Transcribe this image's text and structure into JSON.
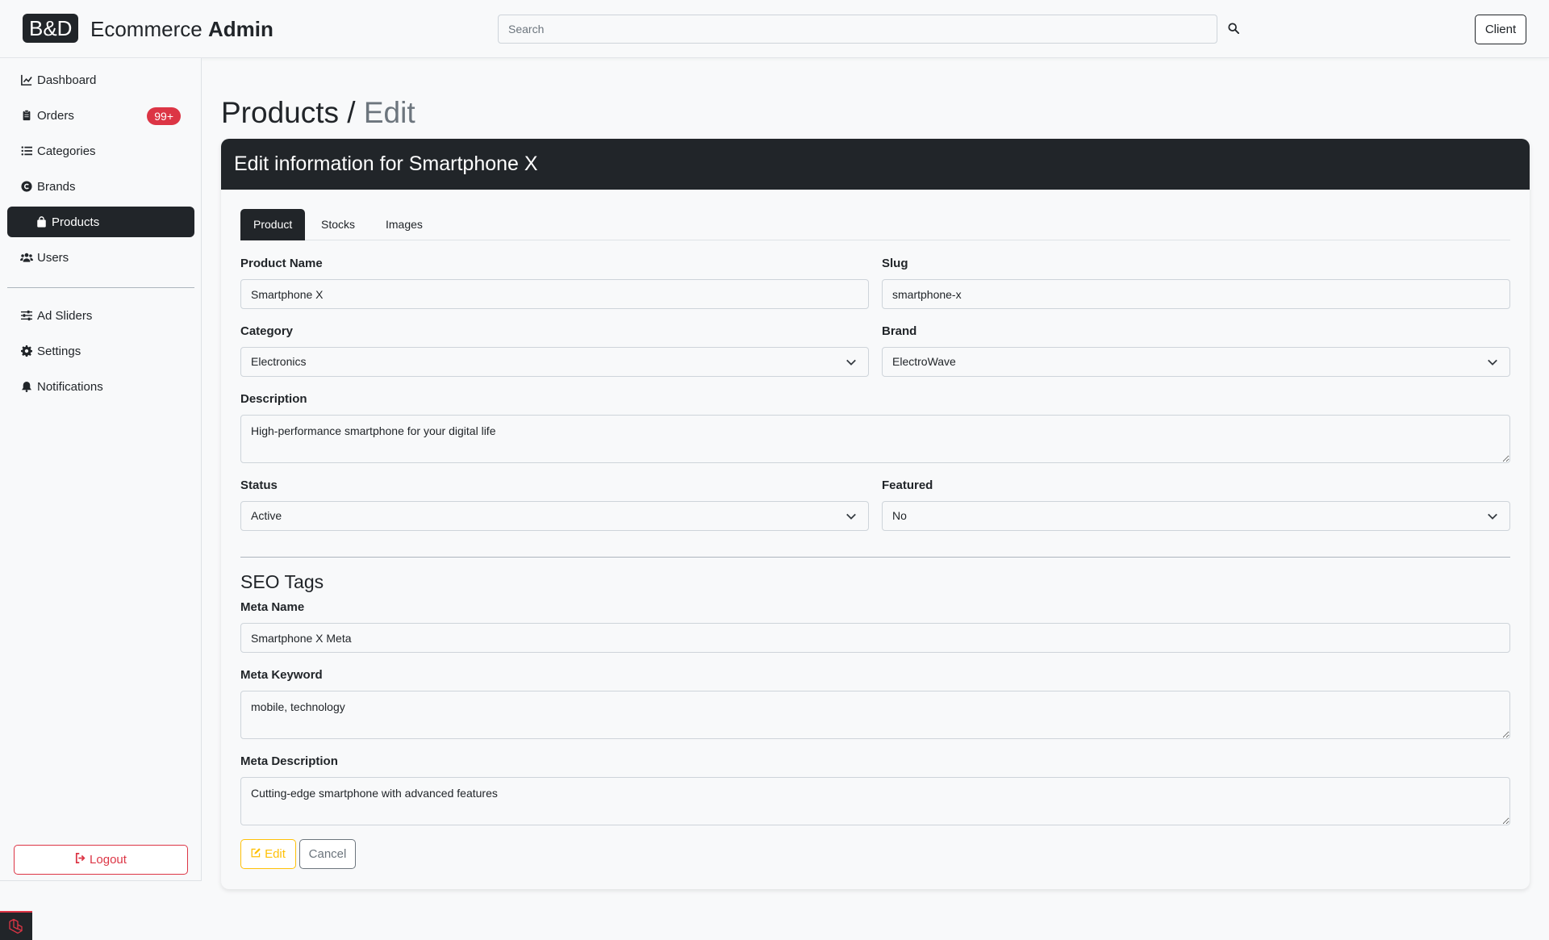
{
  "navbar": {
    "logo": "B&D",
    "brand_regular": "Ecommerce",
    "brand_bold": "Admin",
    "search_placeholder": "Search",
    "search_value": "",
    "client_label": "Client"
  },
  "sidebar": {
    "items": [
      {
        "label": "Dashboard",
        "icon": "chart-line-icon"
      },
      {
        "label": "Orders",
        "icon": "clipboard-icon",
        "badge": "99+"
      },
      {
        "label": "Categories",
        "icon": "list-icon"
      },
      {
        "label": "Brands",
        "icon": "copyright-icon"
      },
      {
        "label": "Products",
        "icon": "shopping-bag-icon",
        "active": true
      },
      {
        "label": "Users",
        "icon": "users-icon"
      }
    ],
    "items_secondary": [
      {
        "label": "Ad Sliders",
        "icon": "sliders-icon"
      },
      {
        "label": "Settings",
        "icon": "gear-icon"
      },
      {
        "label": "Notifications",
        "icon": "bell-icon"
      }
    ],
    "logout_label": "Logout"
  },
  "page": {
    "title_main": "Products /",
    "title_sub": "Edit"
  },
  "card": {
    "header": "Edit information for Smartphone X",
    "tabs": [
      "Product",
      "Stocks",
      "Images"
    ],
    "active_tab": "Product"
  },
  "form": {
    "product_name": {
      "label": "Product Name",
      "value": "Smartphone X"
    },
    "slug": {
      "label": "Slug",
      "value": "smartphone-x"
    },
    "category": {
      "label": "Category",
      "value": "Electronics"
    },
    "brand": {
      "label": "Brand",
      "value": "ElectroWave"
    },
    "description": {
      "label": "Description",
      "value": "High-performance smartphone for your digital life"
    },
    "status": {
      "label": "Status",
      "value": "Active"
    },
    "featured": {
      "label": "Featured",
      "value": "No"
    },
    "seo_title": "SEO Tags",
    "meta_name": {
      "label": "Meta Name",
      "value": "Smartphone X Meta"
    },
    "meta_keyword": {
      "label": "Meta Keyword",
      "value": "mobile, technology"
    },
    "meta_description": {
      "label": "Meta Description",
      "value": "Cutting-edge smartphone with advanced features"
    },
    "edit_label": "Edit",
    "cancel_label": "Cancel"
  },
  "colors": {
    "dark": "#212529",
    "danger": "#dc3545",
    "warning": "#ffc107",
    "secondary": "#6c757d"
  }
}
